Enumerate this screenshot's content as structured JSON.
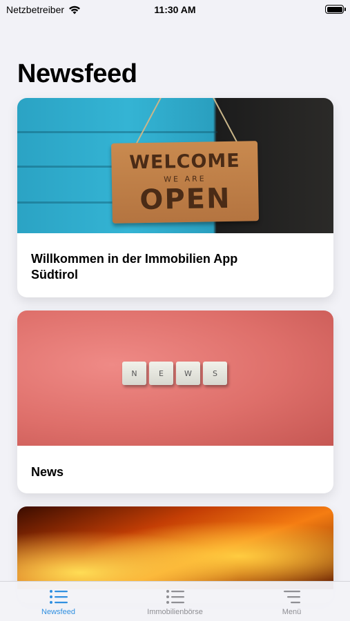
{
  "status_bar": {
    "carrier": "Netzbetreiber",
    "time": "11:30 AM",
    "wifi_icon": "wifi-icon",
    "battery_icon": "battery-icon"
  },
  "page": {
    "title": "Newsfeed"
  },
  "feed": {
    "cards": [
      {
        "title": "Willkommen in der Immobilien App Südtirol",
        "image": {
          "line1": "WELCOME",
          "line2": "WE ARE",
          "line3": "OPEN"
        }
      },
      {
        "title": "News",
        "image": {
          "tiles": [
            "N",
            "E",
            "W",
            "S"
          ]
        }
      },
      {
        "title": "",
        "image": {}
      }
    ]
  },
  "tab_bar": {
    "tabs": [
      {
        "label": "Newsfeed",
        "icon": "list-icon",
        "active": true
      },
      {
        "label": "Immobilienbörse",
        "icon": "list-icon",
        "active": false
      },
      {
        "label": "Menü",
        "icon": "menu-icon",
        "active": false
      }
    ]
  },
  "colors": {
    "accent": "#2f8fe0",
    "background": "#f2f2f7",
    "inactive_tab": "#8e8e93"
  }
}
